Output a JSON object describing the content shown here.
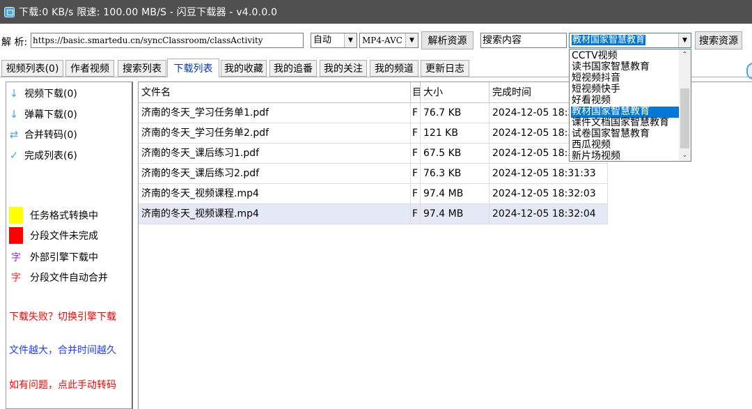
{
  "window": {
    "title": "下载:0 KB/s  限速:  100.00 MB/S  - 闪豆下载器 - v4.0.0.0"
  },
  "toolbar": {
    "url_label": "解 析:",
    "url_value": "https://basic.smartedu.cn/syncClassroom/classActivity",
    "mode_value": "自动",
    "format_value": "MP4-AVC",
    "parse_button": "解析资源",
    "search_value": "搜索内容",
    "site_value": "教材国家智慧教育",
    "search_button": "搜索资源"
  },
  "tabs": [
    {
      "label": "视频列表(0)"
    },
    {
      "label": "作者视频"
    },
    {
      "label": "搜索列表"
    },
    {
      "label": "下载列表",
      "active": true
    },
    {
      "label": "我的收藏"
    },
    {
      "label": "我的追番"
    },
    {
      "label": "我的关注"
    },
    {
      "label": "我的频道"
    },
    {
      "label": "更新日志"
    }
  ],
  "sidebar": {
    "items": [
      {
        "icon": "arrow-down-icon",
        "label": "视频下载(0)"
      },
      {
        "icon": "arrow-down-icon",
        "label": "弹幕下载(0)"
      },
      {
        "icon": "swap-arrows-icon",
        "label": "合并转码(0)"
      },
      {
        "icon": "check-icon",
        "label": "完成列表(6)"
      }
    ],
    "legend": [
      {
        "type": "swatch",
        "color": "#ffff00",
        "label": "任务格式转换中"
      },
      {
        "type": "swatch",
        "color": "#ff0000",
        "label": "分段文件未完成"
      },
      {
        "type": "glyph",
        "glyph": "字",
        "color": "#8a2be2",
        "label": "外部引擎下载中"
      },
      {
        "type": "glyph",
        "glyph": "字",
        "color": "#ff2020",
        "label": "分段文件自动合并"
      }
    ],
    "notes": [
      {
        "text": "下载失败？切换引擎下载",
        "color": "#ff0000"
      },
      {
        "text": "文件越大，合并时间越久",
        "color": "#1e3cff"
      },
      {
        "text": "如有问题，点此手动转码",
        "color": "#ff0000"
      }
    ]
  },
  "table": {
    "headers": [
      "文件名",
      "目",
      "大小",
      "完成时间"
    ],
    "rows": [
      {
        "name": "济南的冬天_学习任务单1.pdf",
        "dir": "F",
        "size": "76.7 KB",
        "time": "2024-12-05 18:31:24"
      },
      {
        "name": "济南的冬天_学习任务单2.pdf",
        "dir": "F",
        "size": "121 KB",
        "time": "2024-12-05 18:31:26"
      },
      {
        "name": "济南的冬天_课后练习1.pdf",
        "dir": "F",
        "size": "67.5 KB",
        "time": "2024-12-05 18:31:30"
      },
      {
        "name": "济南的冬天_课后练习2.pdf",
        "dir": "F",
        "size": "76.3 KB",
        "time": "2024-12-05 18:31:33"
      },
      {
        "name": "济南的冬天_视频课程.mp4",
        "dir": "F",
        "size": "97.4 MB",
        "time": "2024-12-05 18:32:03"
      },
      {
        "name": "济南的冬天_视频课程.mp4",
        "dir": "F",
        "size": "97.4 MB",
        "time": "2024-12-05 18:32:04",
        "selected": true
      }
    ]
  },
  "site_dropdown": {
    "options": [
      "CCTV视频",
      "读书国家智慧教育",
      "短视频抖音",
      "短视频快手",
      "好看视频",
      "教材国家智慧教育",
      "课件文档国家智慧教育",
      "试卷国家智慧教育",
      "西瓜视频",
      "新片场视频"
    ],
    "highlighted_index": 5
  }
}
